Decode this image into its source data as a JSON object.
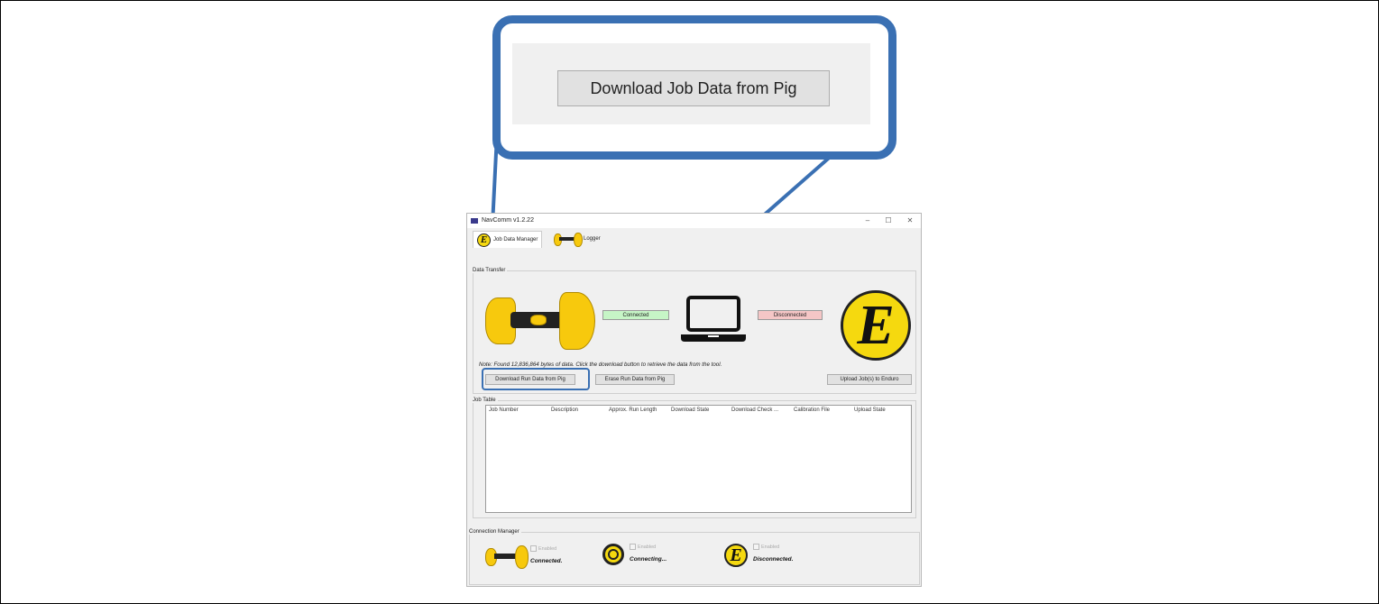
{
  "window": {
    "title": "NavComm v1.2.22",
    "controls": {
      "minimize": "–",
      "maximize": "☐",
      "close": "✕"
    }
  },
  "tabs": [
    {
      "label": "Job Data Manager",
      "icon": "enduro-e-logo-icon"
    },
    {
      "label": "Logger",
      "icon": "pig-tool-icon"
    }
  ],
  "logo_letter": "E",
  "data_transfer": {
    "legend": "Data Transfer",
    "pig_status": "Connected",
    "enduro_status": "Disconnected",
    "note": "Note:  Found 12,836,864 bytes of data. Click the download button to retrieve the data from the tool.",
    "buttons": {
      "download": "Download Run Data from Pig",
      "erase": "Erase Run Data from Pig",
      "upload": "Upload Job(s) to Enduro"
    }
  },
  "job_table": {
    "legend": "Job Table",
    "columns": [
      "Job Number",
      "Description",
      "Approx. Run Length",
      "Download State",
      "Download Check ...",
      "Calibration File",
      "Upload State"
    ],
    "rows": []
  },
  "connection_manager": {
    "legend": "Connection Manager",
    "items": [
      {
        "icon": "pig-tool-icon",
        "checkbox_label": "Enabled",
        "status": "Connected."
      },
      {
        "icon": "logger-beacon-icon",
        "checkbox_label": "Enabled",
        "status": "Connecting..."
      },
      {
        "icon": "enduro-e-logo-icon",
        "checkbox_label": "Enabled",
        "status": "Disconnected."
      }
    ]
  },
  "callout": {
    "button_label": "Download Job Data from Pig"
  },
  "colors": {
    "callout_border": "#3a70b3",
    "connected_bg": "#c6f5c6",
    "disconnected_bg": "#f5c6c6",
    "logo_yellow": "#f5d90f"
  }
}
